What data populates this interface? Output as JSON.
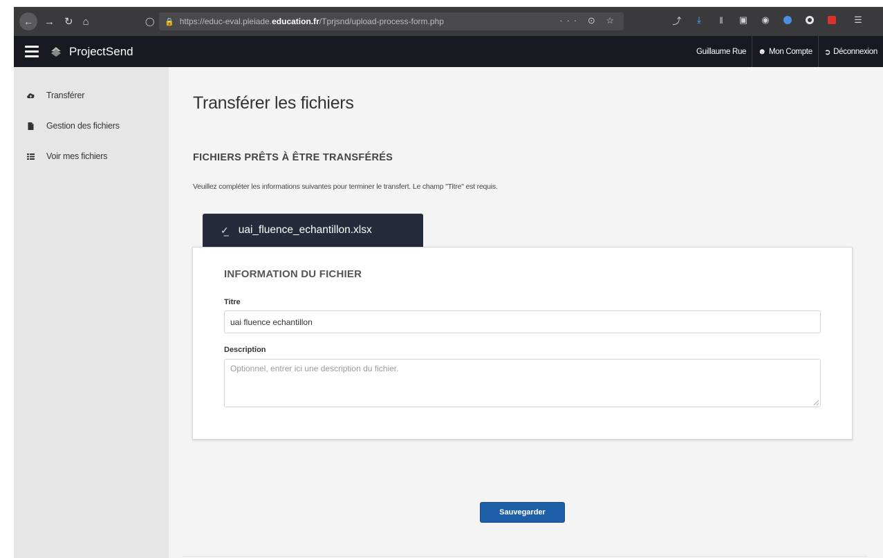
{
  "browser": {
    "url_prefix": "https://educ-eval.pleiade.",
    "url_domain": "education.fr",
    "url_path": "/Tprjsnd/upload-process-form.php",
    "page_actions": "··· ⊙ ☆"
  },
  "header": {
    "app_name": "ProjectSend",
    "user_name": "Guillaume Rue",
    "account_label": "Mon Compte",
    "logout_label": "Déconnexion"
  },
  "sidebar": {
    "items": [
      {
        "label": "Transférer",
        "icon": "cloud-upload-icon"
      },
      {
        "label": "Gestion des fichiers",
        "icon": "file-icon"
      },
      {
        "label": "Voir mes fichiers",
        "icon": "list-icon"
      }
    ]
  },
  "main": {
    "page_title": "Transférer les fichiers",
    "section_title": "FICHIERS PRÊTS À ÊTRE TRANSFÉRÉS",
    "instructions": "Veuillez compléter les informations suivantes pour terminer le transfert. Le champ \"Titre\" est requis.",
    "file_tab": {
      "filename": "uai_fluence_echantillon.xlsx"
    },
    "card": {
      "title": "INFORMATION DU FICHIER",
      "title_label": "Titre",
      "title_value": "uai fluence echantillon",
      "description_label": "Description",
      "description_placeholder": "Optionnel, entrer ici une description du fichier."
    },
    "save_label": "Sauvegarder"
  },
  "colors": {
    "header_bg": "#171a20",
    "sidebar_bg": "#e6e6e6",
    "file_tab_bg": "#252b3b",
    "save_button": "#1f5fa8"
  }
}
